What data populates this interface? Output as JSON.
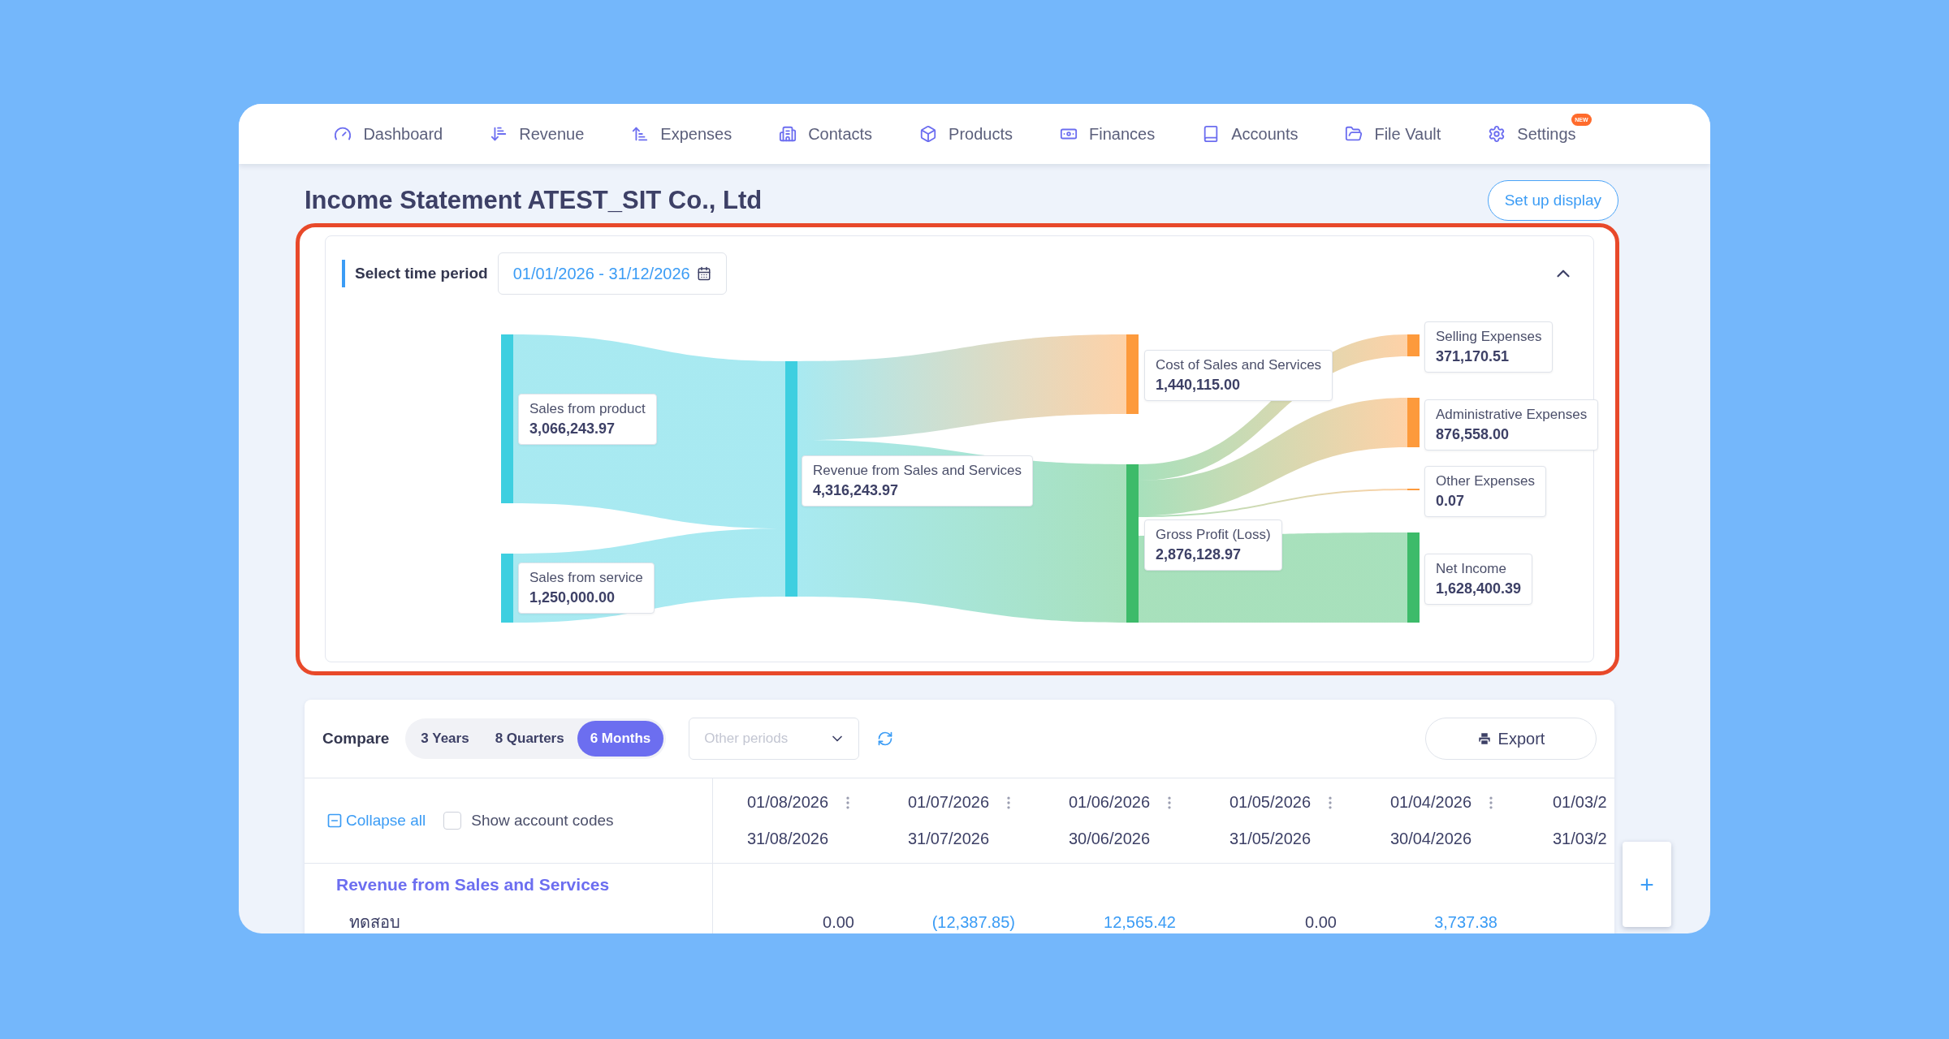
{
  "nav": {
    "items": [
      {
        "label": "Dashboard"
      },
      {
        "label": "Revenue"
      },
      {
        "label": "Expenses"
      },
      {
        "label": "Contacts"
      },
      {
        "label": "Products"
      },
      {
        "label": "Finances"
      },
      {
        "label": "Accounts"
      },
      {
        "label": "File Vault"
      },
      {
        "label": "Settings",
        "badge": "NEW"
      }
    ]
  },
  "page": {
    "title": "Income Statement ATEST_SIT Co., Ltd",
    "setup_button": "Set up display"
  },
  "period": {
    "label": "Select time period",
    "value": "01/01/2026 - 31/12/2026",
    "expanded": true
  },
  "sankey": {
    "nodes": [
      {
        "name": "Sales from product",
        "value": "3,066,243.97",
        "color": "#3ecfe0"
      },
      {
        "name": "Sales from service",
        "value": "1,250,000.00",
        "color": "#3ecfe0"
      },
      {
        "name": "Revenue from Sales and Services",
        "value": "4,316,243.97",
        "color": "#3ecfe0"
      },
      {
        "name": "Cost of Sales and Services",
        "value": "1,440,115.00",
        "color": "#fd9a3c"
      },
      {
        "name": "Gross Profit (Loss)",
        "value": "2,876,128.97",
        "color": "#3dbb6a"
      },
      {
        "name": "Selling Expenses",
        "value": "371,170.51",
        "color": "#fd9a3c"
      },
      {
        "name": "Administrative Expenses",
        "value": "876,558.00",
        "color": "#fd9a3c"
      },
      {
        "name": "Other Expenses",
        "value": "0.07",
        "color": "#fd9a3c"
      },
      {
        "name": "Net Income",
        "value": "1,628,400.39",
        "color": "#3dbb6a"
      }
    ]
  },
  "compare": {
    "label": "Compare",
    "options": [
      {
        "label": "3 Years",
        "selected": false
      },
      {
        "label": "8 Quarters",
        "selected": false
      },
      {
        "label": "6 Months",
        "selected": true
      }
    ],
    "other_periods": {
      "placeholder": "Other periods"
    },
    "export_button": "Export"
  },
  "table": {
    "collapse_all": "Collapse all",
    "show_codes": {
      "label": "Show account codes",
      "checked": false
    },
    "add_button": "+",
    "columns": [
      {
        "start": "01/08/2026",
        "end": "31/08/2026",
        "menu": true
      },
      {
        "start": "01/07/2026",
        "end": "31/07/2026",
        "menu": true
      },
      {
        "start": "01/06/2026",
        "end": "30/06/2026",
        "menu": true
      },
      {
        "start": "01/05/2026",
        "end": "31/05/2026",
        "menu": true
      },
      {
        "start": "01/04/2026",
        "end": "30/04/2026",
        "menu": true
      },
      {
        "start": "01/03/2",
        "end": "31/03/2"
      }
    ],
    "rows": [
      {
        "kind": "group",
        "label": "Revenue from Sales and Services"
      },
      {
        "kind": "account",
        "label": "ทดสอบ",
        "cells": [
          {
            "value": "0.00",
            "linked": false
          },
          {
            "value": "(12,387.85)",
            "linked": true
          },
          {
            "value": "12,565.42",
            "linked": true
          },
          {
            "value": "0.00",
            "linked": false
          },
          {
            "value": "3,737.38",
            "linked": true
          }
        ]
      }
    ]
  }
}
